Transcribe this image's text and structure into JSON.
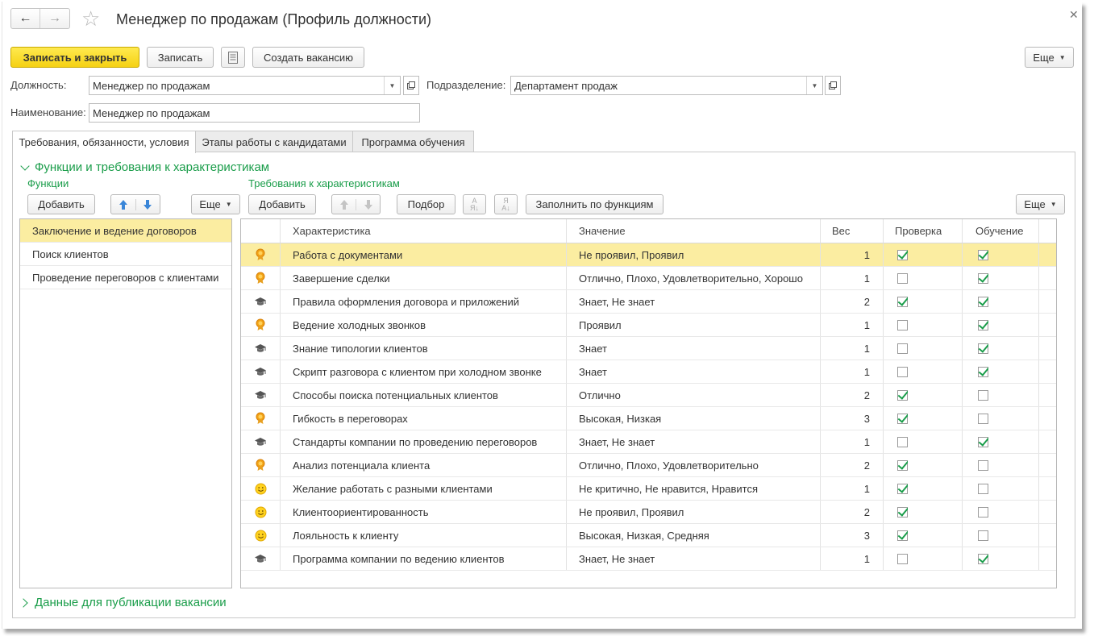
{
  "window": {
    "title": "Менеджер по продажам (Профиль должности)"
  },
  "toolbar": {
    "write_close": "Записать и закрыть",
    "write": "Записать",
    "create_vacancy": "Создать вакансию",
    "more": "Еще"
  },
  "fields": {
    "position_label": "Должность:",
    "position_value": "Менеджер по продажам",
    "department_label": "Подразделение:",
    "department_value": "Департамент продаж",
    "name_label": "Наименование:",
    "name_value": "Менеджер по продажам"
  },
  "tabs": [
    {
      "label": "Требования, обязанности, условия",
      "active": true
    },
    {
      "label": "Этапы работы с кандидатами",
      "active": false
    },
    {
      "label": "Программа обучения",
      "active": false
    }
  ],
  "section": {
    "title": "Функции и требования к характеристикам",
    "footer": "Данные для публикации вакансии"
  },
  "functions": {
    "title": "Функции",
    "add": "Добавить",
    "more": "Еще",
    "items": [
      {
        "label": "Заключение и ведение договоров",
        "selected": true
      },
      {
        "label": "Поиск клиентов",
        "selected": false
      },
      {
        "label": "Проведение переговоров с клиентами",
        "selected": false
      }
    ]
  },
  "requirements": {
    "title": "Требования к характеристикам",
    "add": "Добавить",
    "pick": "Подбор",
    "fill": "Заполнить по функциям",
    "more": "Еще",
    "columns": {
      "characteristic": "Характеристика",
      "value": "Значение",
      "weight": "Вес",
      "check": "Проверка",
      "training": "Обучение"
    },
    "rows": [
      {
        "icon": "award-icon",
        "name": "Работа с документами",
        "value": "Не проявил, Проявил",
        "weight": "1",
        "check": true,
        "training": true,
        "selected": true
      },
      {
        "icon": "award-icon",
        "name": "Завершение сделки",
        "value": "Отлично, Плохо, Удовлетворительно, Хорошо",
        "weight": "1",
        "check": false,
        "training": true
      },
      {
        "icon": "graduation-cap-icon",
        "name": "Правила оформления договора и приложений",
        "value": "Знает, Не знает",
        "weight": "2",
        "check": true,
        "training": true
      },
      {
        "icon": "award-icon",
        "name": "Ведение холодных звонков",
        "value": "Проявил",
        "weight": "1",
        "check": false,
        "training": true
      },
      {
        "icon": "graduation-cap-icon",
        "name": "Знание типологии клиентов",
        "value": "Знает",
        "weight": "1",
        "check": false,
        "training": true
      },
      {
        "icon": "graduation-cap-icon",
        "name": "Скрипт разговора с клиентом при холодном звонке",
        "value": "Знает",
        "weight": "1",
        "check": false,
        "training": true
      },
      {
        "icon": "graduation-cap-icon",
        "name": "Способы поиска потенциальных клиентов",
        "value": "Отлично",
        "weight": "2",
        "check": true,
        "training": false
      },
      {
        "icon": "award-icon",
        "name": "Гибкость в переговорах",
        "value": "Высокая, Низкая",
        "weight": "3",
        "check": true,
        "training": false
      },
      {
        "icon": "graduation-cap-icon",
        "name": "Стандарты компании по проведению переговоров",
        "value": "Знает, Не знает",
        "weight": "1",
        "check": false,
        "training": true
      },
      {
        "icon": "award-icon",
        "name": "Анализ потенциала клиента",
        "value": "Отлично, Плохо, Удовлетворительно",
        "weight": "2",
        "check": true,
        "training": false
      },
      {
        "icon": "smiley-icon",
        "name": "Желание работать с разными клиентами",
        "value": "Не критично, Не нравится, Нравится",
        "weight": "1",
        "check": true,
        "training": false
      },
      {
        "icon": "smiley-icon",
        "name": "Клиентоориентированность",
        "value": "Не проявил, Проявил",
        "weight": "2",
        "check": true,
        "training": false
      },
      {
        "icon": "smiley-icon",
        "name": "Лояльность к клиенту",
        "value": "Высокая, Низкая, Средняя",
        "weight": "3",
        "check": true,
        "training": false
      },
      {
        "icon": "graduation-cap-icon",
        "name": "Программа компании по ведению клиентов",
        "value": "Знает, Не знает",
        "weight": "1",
        "check": false,
        "training": true
      }
    ]
  },
  "colors": {
    "accent_green": "#1a9d4a",
    "primary_button": "#f5d113",
    "selection": "#fbeda1"
  }
}
